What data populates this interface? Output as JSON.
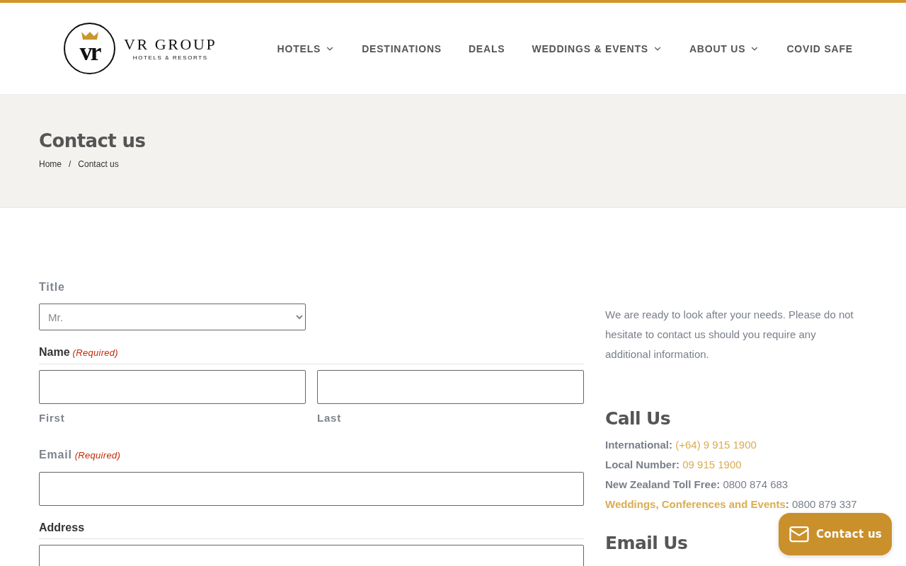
{
  "header": {
    "logo": {
      "monogram": "vr",
      "wordmark": "VR GROUP",
      "tagline": "HOTELS & RESORTS"
    },
    "nav": [
      {
        "label": "HOTELS",
        "dropdown": true
      },
      {
        "label": "DESTINATIONS",
        "dropdown": false
      },
      {
        "label": "DEALS",
        "dropdown": false
      },
      {
        "label": "WEDDINGS & EVENTS",
        "dropdown": true
      },
      {
        "label": "ABOUT US",
        "dropdown": true
      },
      {
        "label": "COVID SAFE",
        "dropdown": false
      }
    ]
  },
  "page_header": {
    "title": "Contact us",
    "breadcrumb": [
      "Home",
      "Contact us"
    ],
    "separator": "/"
  },
  "form": {
    "fields": [
      {
        "kind": "select",
        "label": "Title",
        "value": "Mr."
      },
      {
        "kind": "name",
        "label": "Name",
        "required_note": "(Required)",
        "inputs": [
          {
            "sublabel": "First"
          },
          {
            "sublabel": "Last"
          }
        ]
      },
      {
        "kind": "text",
        "label": "Email",
        "required_note": "(Required)"
      },
      {
        "kind": "address",
        "label": "Address"
      }
    ]
  },
  "contact_info": {
    "intro": "We are ready to look after your needs. Please do not hesitate to contact us should you require any additional information.",
    "call_heading": "Call Us",
    "phone_lines": [
      {
        "label": "International:",
        "value": "(+64) 9 915 1900",
        "label_link": false,
        "value_link": true
      },
      {
        "label": "Local Number:",
        "value": "09 915 1900",
        "label_link": false,
        "value_link": true
      },
      {
        "label": "New Zealand Toll Free:",
        "value": "0800 874 683",
        "label_link": false,
        "value_link": false
      },
      {
        "label": "Weddings, Conferences and Events",
        "label_suffix": ":",
        "value": "0800 879 337",
        "label_link": true,
        "value_link": false
      }
    ],
    "email_heading": "Email Us"
  },
  "floating_button": {
    "label": "Contact us"
  }
}
